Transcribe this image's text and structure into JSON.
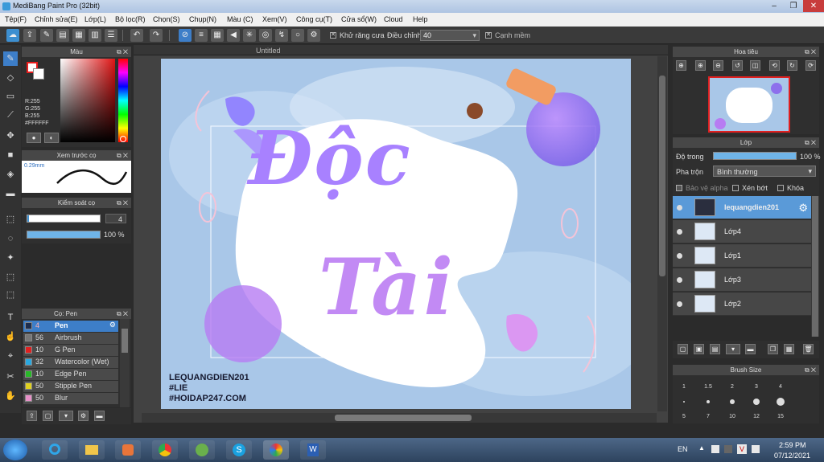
{
  "window": {
    "title": "MediBang Paint Pro (32bit)"
  },
  "menu": [
    "Tệp(F)",
    "Chỉnh sửa(E)",
    "Lớp(L)",
    "Bộ lọc(R)",
    "Chọn(S)",
    "Chụp(N)",
    "Màu (C)",
    "Xem(V)",
    "Công cụ(T)",
    "Cửa sổ(W)",
    "Cloud",
    "Help"
  ],
  "toolbar": {
    "antialias_label": "Khử răng cưa",
    "adjust_label": "Điều chỉnh",
    "adjust_value": "40",
    "sharp_label": "Cạnh mềm"
  },
  "color_panel": {
    "title": "Màu",
    "r": "R:255",
    "g": "G:255",
    "b": "B:255",
    "hex": "#FFFFFF",
    "accent": "#e81c1c"
  },
  "brush_preview": {
    "title": "Xem trước cọ",
    "size": "0.29mm"
  },
  "brush_control": {
    "title": "Kiểm soát cọ",
    "size_value": "4",
    "opacity_value": "100 %",
    "opacity": 1.0
  },
  "brush_list": {
    "title": "Cọ: Pen",
    "items": [
      {
        "size": "4",
        "name": "Pen",
        "color": "#1e2e4e",
        "selected": true
      },
      {
        "size": "56",
        "name": "Airbrush",
        "color": "#777777"
      },
      {
        "size": "10",
        "name": "G Pen",
        "color": "#e02020"
      },
      {
        "size": "32",
        "name": "Watercolor (Wet)",
        "color": "#2aa8e0"
      },
      {
        "size": "10",
        "name": "Edge Pen",
        "color": "#28b828"
      },
      {
        "size": "50",
        "name": "Stipple Pen",
        "color": "#e0d020"
      },
      {
        "size": "50",
        "name": "Blur",
        "color": "#e890c8"
      }
    ]
  },
  "document": {
    "tab": "Untitled",
    "art_line1": "Độc",
    "art_line2": "Tài",
    "watermark_1": "LEQUANGDIEN201",
    "watermark_2": "#LIE",
    "watermark_3": "#HOIDAP247.COM"
  },
  "navigator": {
    "title": "Hoa tiêu"
  },
  "layers": {
    "title": "Lớp",
    "opacity_label": "Độ trong",
    "opacity_value": "100 %",
    "blend_label": "Pha trộn",
    "blend_value": "Bình thường",
    "protect_alpha": "Bảo vệ alpha",
    "clipping": "Xén bớt",
    "lock": "Khóa",
    "items": [
      {
        "name": "lequangdien201",
        "selected": true
      },
      {
        "name": "Lớp4"
      },
      {
        "name": "Lớp1"
      },
      {
        "name": "Lớp3"
      },
      {
        "name": "Lớp2"
      }
    ]
  },
  "brush_size": {
    "title": "Brush Size",
    "row1": [
      "1",
      "1.5",
      "2",
      "3",
      "4"
    ],
    "row3": [
      "5",
      "7",
      "10",
      "12",
      "15"
    ]
  },
  "taskbar": {
    "lang": "EN",
    "time": "2:59 PM",
    "date": "07/12/2021"
  }
}
